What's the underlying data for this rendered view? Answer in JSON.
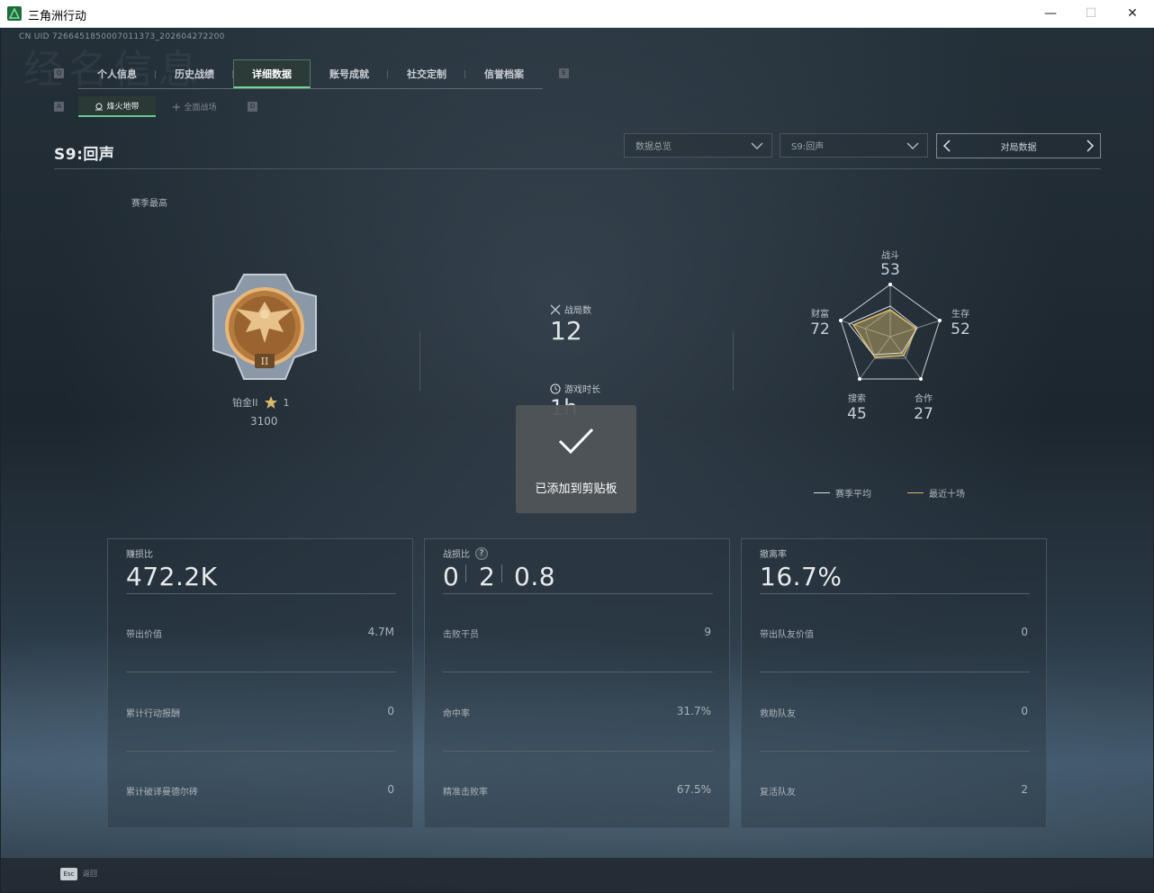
{
  "window": {
    "title": "三角洲行动",
    "minimize": "—",
    "maximize": "☐",
    "close": "✕"
  },
  "uid": "CN UID 7266451850007011373_202604272200",
  "bg_text": "经名信息",
  "key_hints": {
    "tab_left": "Q",
    "tab_right": "E",
    "sub_left": "A",
    "sub_right": "D"
  },
  "tabs": [
    {
      "label": "个人信息"
    },
    {
      "label": "历史战绩"
    },
    {
      "label": "详细数据",
      "active": true
    },
    {
      "label": "账号成就"
    },
    {
      "label": "社交定制"
    },
    {
      "label": "信誉档案"
    }
  ],
  "subtabs": [
    {
      "label": "烽火地带",
      "active": true
    },
    {
      "label": "全面战场"
    }
  ],
  "season_title": "S9:回声",
  "dropdowns": {
    "data_type": "数据总览",
    "season": "S9:回声"
  },
  "pager_label": "对局数据",
  "season_best_label": "赛季最高",
  "rank": {
    "name": "铂金II",
    "stars": "1",
    "score": "3100",
    "badge_numeral": "II"
  },
  "battles": {
    "label": "战局数",
    "value": "12",
    "playtime_label": "游戏时长",
    "playtime_value": "1h"
  },
  "radar": {
    "labels": {
      "combat": "战斗",
      "survival": "生存",
      "teamwork": "合作",
      "search": "搜索",
      "wealth": "财富"
    },
    "values": {
      "combat": "53",
      "survival": "52",
      "teamwork": "27",
      "search": "45",
      "wealth": "72"
    },
    "legend_season": "赛季平均",
    "legend_recent": "最近十场",
    "color_season": "#d9dde0",
    "color_recent": "#d8b96a"
  },
  "toast": {
    "text": "已添加到剪贴板"
  },
  "cards": [
    {
      "label": "赚损比",
      "value": "472.2K",
      "rows": [
        {
          "label": "带出价值",
          "value": "4.7M"
        },
        {
          "label": "累计行动报酬",
          "value": "0"
        },
        {
          "label": "累计破译曼德尔砖",
          "value": "0"
        }
      ]
    },
    {
      "label": "战损比",
      "help": "?",
      "values": [
        "0",
        "2",
        "0.8"
      ],
      "rows": [
        {
          "label": "击败干员",
          "value": "9"
        },
        {
          "label": "命中率",
          "value": "31.7%"
        },
        {
          "label": "精准击败率",
          "value": "67.5%"
        }
      ]
    },
    {
      "label": "撤离率",
      "value": "16.7%",
      "rows": [
        {
          "label": "带出队友价值",
          "value": "0"
        },
        {
          "label": "救助队友",
          "value": "0"
        },
        {
          "label": "复活队友",
          "value": "2"
        }
      ]
    }
  ],
  "footer": {
    "esc_key": "Esc",
    "esc_label": "返回"
  }
}
